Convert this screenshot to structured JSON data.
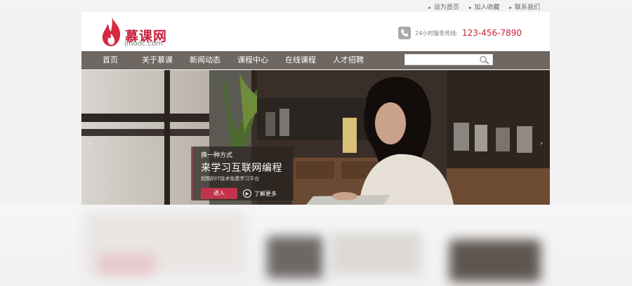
{
  "top_links": [
    {
      "label": "设为首页"
    },
    {
      "label": "加入收藏"
    },
    {
      "label": "联系我们"
    }
  ],
  "brand": {
    "name_cn": "慕课网",
    "domain": "imooc.com",
    "accent_color": "#c8203c"
  },
  "hotline": {
    "label": "24小时服务热线:",
    "number": "123-456-7890",
    "icon": "phone-icon"
  },
  "nav": {
    "items": [
      {
        "label": "首页"
      },
      {
        "label": "关于慕课"
      },
      {
        "label": "新闻动态"
      },
      {
        "label": "课程中心"
      },
      {
        "label": "在线课程"
      },
      {
        "label": "人才招聘"
      }
    ],
    "background": "#6f6761"
  },
  "search": {
    "placeholder": "",
    "value": "",
    "icon": "search-icon"
  },
  "banner": {
    "caption_sub": "换一种方式",
    "caption_title": "来学习互联网编程",
    "caption_desc": "超酷的IT技术免费学习平台",
    "enter_label": "进入",
    "more_label": "了解更多",
    "prev_icon": "chevron-left-icon",
    "next_icon": "chevron-right-icon"
  }
}
